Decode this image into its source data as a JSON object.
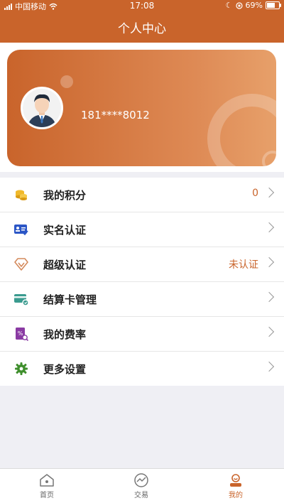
{
  "status_bar": {
    "carrier": "中国移动",
    "time": "17:08",
    "battery": "69%"
  },
  "navbar": {
    "title": "个人中心"
  },
  "profile": {
    "phone": "181****8012"
  },
  "menu": [
    {
      "label": "我的积分",
      "value": "0",
      "icon": "coins-icon"
    },
    {
      "label": "实名认证",
      "value": "",
      "icon": "id-card-icon"
    },
    {
      "label": "超级认证",
      "value": "未认证",
      "icon": "diamond-icon"
    },
    {
      "label": "结算卡管理",
      "value": "",
      "icon": "bank-card-icon"
    },
    {
      "label": "我的费率",
      "value": "",
      "icon": "rate-icon"
    },
    {
      "label": "更多设置",
      "value": "",
      "icon": "gear-icon"
    }
  ],
  "tabbar": {
    "home": "首页",
    "trade": "交易",
    "mine": "我的"
  },
  "colors": {
    "accent": "#c9642b"
  }
}
